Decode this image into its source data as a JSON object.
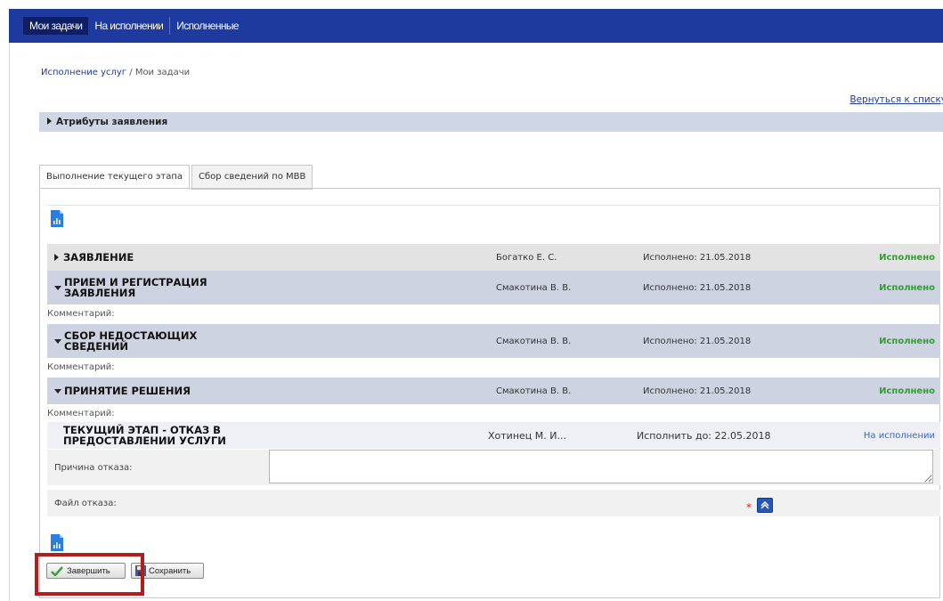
{
  "nav": {
    "tabs": [
      {
        "label": "Мои задачи",
        "active": true
      },
      {
        "label": "На исполнении",
        "active": false
      },
      {
        "label": "Исполненные",
        "active": false
      }
    ]
  },
  "breadcrumb": {
    "link": "Исполнение услуг",
    "separator": " / ",
    "current": "Мои задачи"
  },
  "back_link": "Вернуться к списку",
  "attributes_section": "Атрибуты заявления",
  "content_tabs": [
    {
      "label": "Выполнение текущего этапа",
      "active": true
    },
    {
      "label": "Сбор сведений по МВВ",
      "active": false
    }
  ],
  "stages": [
    {
      "name": "ЗАЯВЛЕНИЕ",
      "expanded": false,
      "executor": "Богатко Е. С.",
      "date": "Исполнено: 21.05.2018",
      "status": "Исполнено"
    },
    {
      "name": "ПРИЕМ И РЕГИСТРАЦИЯ ЗАЯВЛЕНИЯ",
      "expanded": true,
      "executor": "Смакотина В. В.",
      "date": "Исполнено: 21.05.2018",
      "status": "Исполнено",
      "comment": "Комментарий:"
    },
    {
      "name": "СБОР НЕДОСТАЮЩИХ СВЕДЕНИЙ",
      "expanded": true,
      "executor": "Смакотина В. В.",
      "date": "Исполнено: 21.05.2018",
      "status": "Исполнено",
      "comment": "Комментарий:"
    },
    {
      "name": "ПРИНЯТИЕ РЕШЕНИЯ",
      "expanded": true,
      "executor": "Смакотина В. В.",
      "date": "Исполнено: 21.05.2018",
      "status": "Исполнено",
      "comment": "Комментарий:"
    }
  ],
  "current_stage": {
    "name": "ТЕКУЩИЙ ЭТАП - ОТКАЗ В ПРЕДОСТАВЛЕНИИ УСЛУГИ",
    "executor": "Хотинец М. И...",
    "date": "Исполнить до: 22.05.2018",
    "status": "На исполнении"
  },
  "form": {
    "reason_label": "Причина отказа:",
    "reason_value": "",
    "file_label": "Файл отказа:",
    "required_mark": "*"
  },
  "buttons": {
    "complete": "Завершить",
    "save": "Сохранить"
  },
  "colors": {
    "nav_bg": "#1e3a9e",
    "done_status": "#2ea02e",
    "in_progress_status": "#3a62c8",
    "highlight": "#b21d1d"
  },
  "icons": [
    "document-chart-icon",
    "checkmark-icon",
    "save-icon",
    "upload-icon"
  ]
}
